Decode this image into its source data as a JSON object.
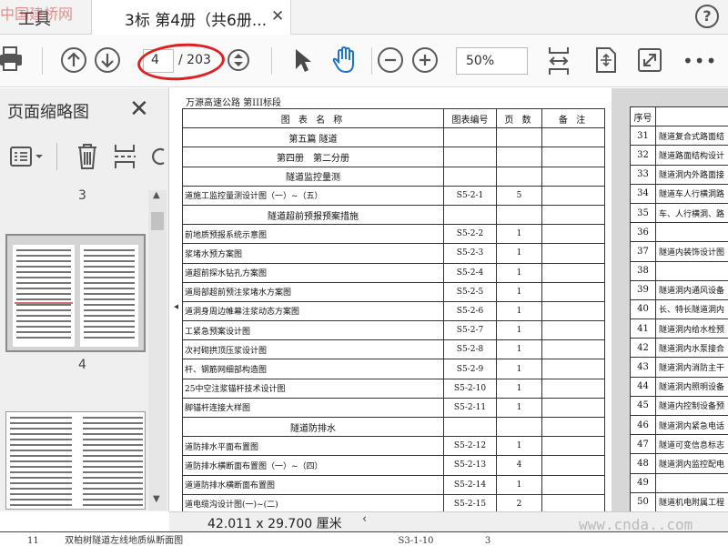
{
  "watermark_top": "中国建桥网",
  "watermark_bottom": "www.cnda..com",
  "tabs": {
    "tools": "工具",
    "document": "3标 第4册（共6册..."
  },
  "toolbar": {
    "page_current": "4",
    "page_total": "/ 203",
    "zoom": "50%"
  },
  "panel": {
    "title": "页面缩略图",
    "thumbs": [
      {
        "label": "3"
      },
      {
        "label": "4"
      }
    ]
  },
  "doc": {
    "project_title": "万源高速公路 第III标段",
    "headers": {
      "name": "图 表 名 称",
      "code": "图表编号",
      "pages": "页 数",
      "remarks": "备 注"
    },
    "sections": {
      "s1": "第五篇 隧道",
      "s2": "第四册　第二分册",
      "s3": "隧道监控量测",
      "s4": "隧道超前预报预案措施",
      "s5": "隧道防排水"
    },
    "rows": [
      {
        "name": "道施工监控量测设计图（一）~（五）",
        "code": "S5-2-1",
        "pages": "5"
      },
      {
        "name": "前地质预报系统示意图",
        "code": "S5-2-2",
        "pages": "1"
      },
      {
        "name": "浆堵水预方案图",
        "code": "S5-2-3",
        "pages": "1"
      },
      {
        "name": "道超前探水钻孔方案图",
        "code": "S5-2-4",
        "pages": "1"
      },
      {
        "name": "道局部超前预注浆堵水方案图",
        "code": "S5-2-5",
        "pages": "1"
      },
      {
        "name": "道洞身周边帷幕注浆动态方案图",
        "code": "S5-2-6",
        "pages": "1"
      },
      {
        "name": "工紧急预案设计图",
        "code": "S5-2-7",
        "pages": "1"
      },
      {
        "name": "次衬砌拱顶压浆设计图",
        "code": "S5-2-8",
        "pages": "1"
      },
      {
        "name": "杆、钢筋网细部构造图",
        "code": "S5-2-9",
        "pages": "1"
      },
      {
        "name": "25中空注浆锚杆技术设计图",
        "code": "S5-2-10",
        "pages": "1"
      },
      {
        "name": "脚锚杆连接大样图",
        "code": "S5-2-11",
        "pages": "1"
      },
      {
        "name": "道防排水平面布置图",
        "code": "S5-2-12",
        "pages": "1"
      },
      {
        "name": "道防排水横断面布置图（一）~（四）",
        "code": "S5-2-13",
        "pages": "4"
      },
      {
        "name": "道道防排水横断面布置图",
        "code": "S5-2-14",
        "pages": "1"
      },
      {
        "name": "道电缆沟设计图(一)~(二)",
        "code": "S5-2-15",
        "pages": "2"
      }
    ],
    "right": {
      "header": "序号",
      "rows": [
        {
          "no": "31",
          "name": "隧道复合式路面结"
        },
        {
          "no": "32",
          "name": "隧道路面结构设计"
        },
        {
          "no": "33",
          "name": "隧道洞内外路面接"
        },
        {
          "no": "34",
          "name": "隧道车人行横洞路"
        },
        {
          "no": "35",
          "name": "车、人行横洞、路"
        },
        {
          "no": "36",
          "name": ""
        },
        {
          "no": "37",
          "name": "隧道内装饰设计图"
        },
        {
          "no": "38",
          "name": ""
        },
        {
          "no": "39",
          "name": "隧道洞内通风设备"
        },
        {
          "no": "40",
          "name": "长、特长隧道洞内"
        },
        {
          "no": "41",
          "name": "隧道洞内给水栓预"
        },
        {
          "no": "42",
          "name": "隧道洞内水泵接合"
        },
        {
          "no": "43",
          "name": "隧道洞内消防主干"
        },
        {
          "no": "44",
          "name": "隧道洞内照明设备"
        },
        {
          "no": "45",
          "name": "隧道内控制设备预"
        },
        {
          "no": "46",
          "name": "隧道洞内紧急电话"
        },
        {
          "no": "47",
          "name": "隧道可变信息标志"
        },
        {
          "no": "48",
          "name": "隧道洞内监控配电"
        },
        {
          "no": "49",
          "name": ""
        },
        {
          "no": "50",
          "name": "隧道机电附属工程"
        }
      ]
    }
  },
  "status": {
    "dims": "42.011 x 29.700 厘米"
  },
  "bottom": {
    "no": "11",
    "name": "双柏树隧道左线地质纵断面图",
    "code": "S3-1-10",
    "pages": "3"
  }
}
